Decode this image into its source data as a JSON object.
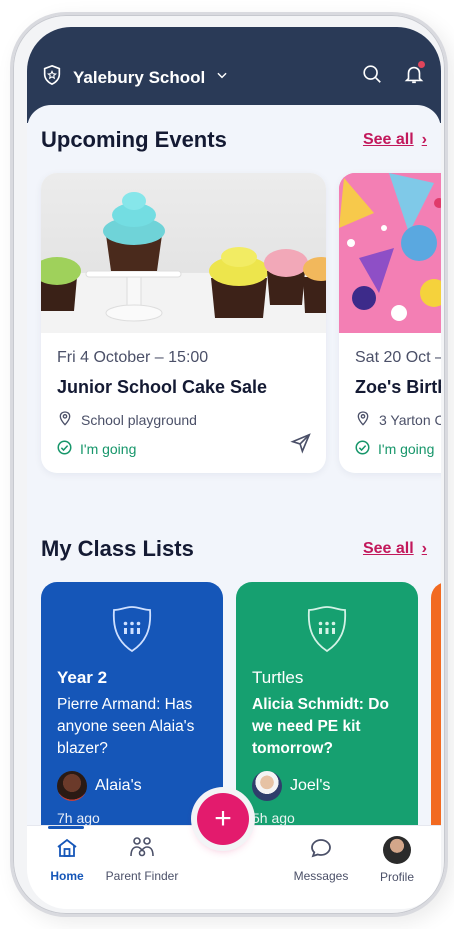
{
  "header": {
    "school_name": "Yalebury School",
    "icons": [
      "shield-icon",
      "chevron-down-icon",
      "search-icon",
      "bell-icon"
    ]
  },
  "events_section": {
    "title": "Upcoming Events",
    "see_all": "See all",
    "events": [
      {
        "date": "Fri 4 October  – 15:00",
        "title": "Junior School Cake Sale",
        "place": "School playground",
        "status": "I'm going"
      },
      {
        "date": "Sat 20 Oct –",
        "title": "Zoe's Birth",
        "place": "3 Yarton C",
        "status": "I'm going"
      }
    ]
  },
  "classes_section": {
    "title": "My Class Lists",
    "see_all": "See all",
    "classes": [
      {
        "name": "Year 2",
        "message": "Pierre Armand: Has anyone seen Alaia's blazer?",
        "author": "Alaia's",
        "time": "7h ago"
      },
      {
        "name": "Turtles",
        "message": "Alicia Schmidt: Do we need PE kit tomorrow?",
        "author": "Joel's",
        "time": "5h ago"
      }
    ]
  },
  "nav": {
    "home": "Home",
    "parent_finder": "Parent Finder",
    "add": "+",
    "messages": "Messages",
    "profile": "Profile"
  },
  "colors": {
    "header": "#2a3a57",
    "accent": "#c2185b",
    "blue_card": "#1556b8",
    "green_card": "#16a070",
    "orange_card": "#f26a21",
    "going_green": "#16966a"
  }
}
